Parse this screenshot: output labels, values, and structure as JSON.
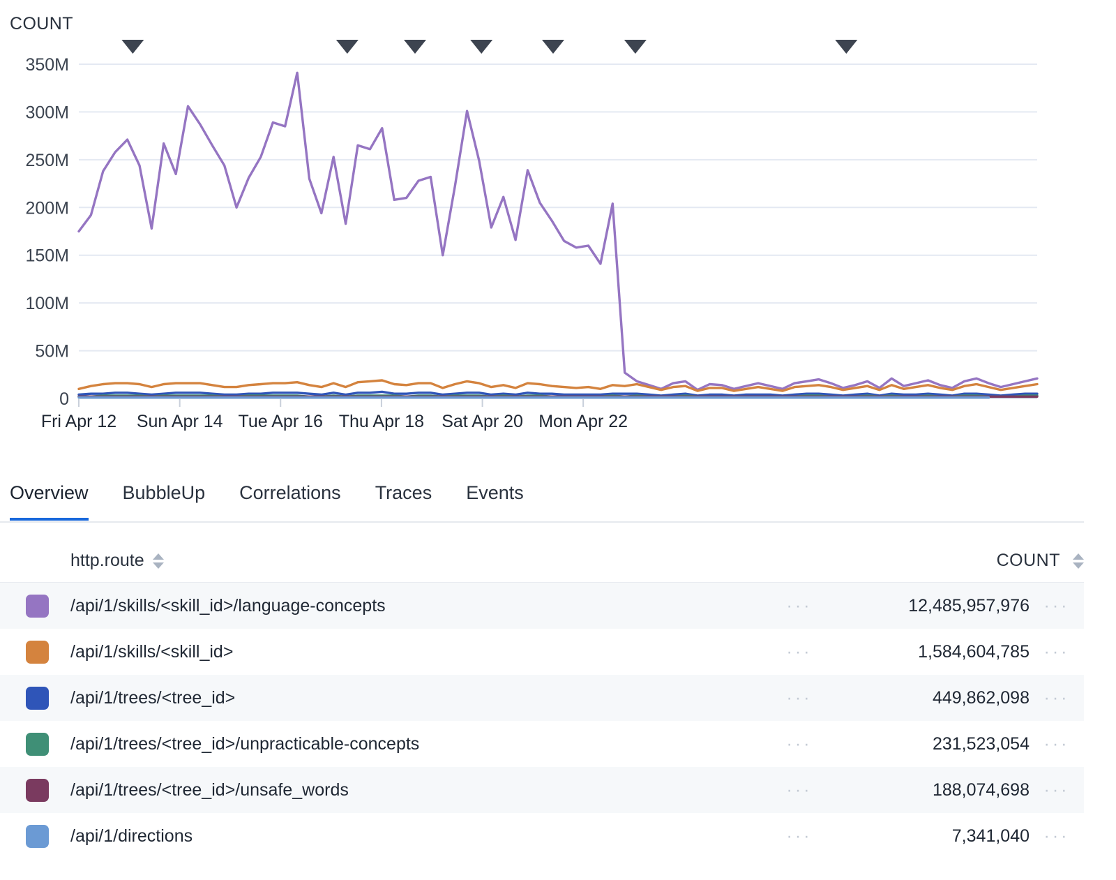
{
  "chart_data": {
    "type": "line",
    "title": "",
    "ylabel": "COUNT",
    "xlabel": "",
    "grid": true,
    "legend_position": "none",
    "ylim": [
      0,
      375000000
    ],
    "ytick_labels": [
      "350M",
      "300M",
      "250M",
      "200M",
      "150M",
      "100M",
      "50M",
      "0"
    ],
    "ytick_values": [
      350000000,
      300000000,
      250000000,
      200000000,
      150000000,
      100000000,
      50000000,
      0
    ],
    "xtick_labels": [
      "Fri Apr 12",
      "Sun Apr 14",
      "Tue Apr 16",
      "Thu Apr 18",
      "Sat Apr 20",
      "Mon Apr 22"
    ],
    "xtick_positions": [
      0,
      0.1053,
      0.2105,
      0.3158,
      0.4211,
      0.5263
    ],
    "annotation_markers": [
      0.0563,
      0.2801,
      0.3508,
      0.4201,
      0.4949,
      0.5807,
      0.8008
    ],
    "series": [
      {
        "name": "/api/1/skills/<skill_id>/language-concepts",
        "color": "#9575c2",
        "values": [
          175,
          192,
          238,
          258,
          271,
          244,
          178,
          267,
          235,
          306,
          287,
          265,
          244,
          200,
          231,
          253,
          289,
          285,
          341,
          230,
          194,
          253,
          183,
          265,
          261,
          283,
          208,
          210,
          228,
          232,
          150,
          222,
          301,
          249,
          179,
          211,
          166,
          239,
          205,
          186,
          165,
          158,
          160,
          141,
          204,
          27,
          18,
          14,
          10,
          16,
          18,
          9,
          15,
          14,
          10,
          13,
          16,
          13,
          10,
          16,
          18,
          20,
          16,
          11,
          14,
          18,
          11,
          21,
          13,
          16,
          19,
          14,
          11,
          18,
          21,
          16,
          12,
          15,
          18,
          21
        ]
      },
      {
        "name": "/api/1/skills/<skill_id>",
        "color": "#d4833e",
        "values": [
          10,
          13,
          15,
          16,
          16,
          15,
          12,
          15,
          16,
          16,
          16,
          14,
          12,
          12,
          14,
          15,
          16,
          16,
          17,
          14,
          12,
          16,
          12,
          17,
          18,
          19,
          15,
          14,
          16,
          16,
          11,
          15,
          18,
          16,
          12,
          14,
          11,
          16,
          15,
          13,
          12,
          11,
          12,
          10,
          14,
          13,
          15,
          12,
          9,
          12,
          13,
          8,
          11,
          11,
          8,
          10,
          12,
          10,
          8,
          12,
          13,
          14,
          12,
          9,
          11,
          13,
          9,
          14,
          10,
          12,
          14,
          11,
          9,
          13,
          15,
          12,
          9,
          11,
          13,
          15
        ]
      },
      {
        "name": "/api/1/trees/<tree_id>",
        "color": "#2f55b8",
        "values": [
          4,
          5,
          5,
          6,
          6,
          5,
          4,
          5,
          6,
          6,
          6,
          5,
          4,
          4,
          5,
          5,
          6,
          6,
          6,
          5,
          4,
          6,
          4,
          6,
          6,
          7,
          5,
          5,
          6,
          6,
          4,
          5,
          6,
          6,
          4,
          5,
          4,
          6,
          5,
          5,
          4,
          4,
          4,
          4,
          5,
          5,
          5,
          4,
          3,
          4,
          5,
          3,
          4,
          4,
          3,
          4,
          4,
          4,
          3,
          4,
          5,
          5,
          4,
          3,
          4,
          5,
          3,
          5,
          4,
          4,
          5,
          4,
          3,
          5,
          5,
          4,
          3,
          4,
          5,
          5
        ]
      },
      {
        "name": "/api/1/trees/<tree_id>/unpracticable-concepts",
        "color": "#3f8f76",
        "values": [
          2,
          2,
          3,
          3,
          3,
          3,
          2,
          3,
          3,
          3,
          3,
          3,
          2,
          2,
          3,
          3,
          3,
          3,
          3,
          2,
          2,
          3,
          2,
          3,
          3,
          3,
          3,
          2,
          3,
          3,
          2,
          3,
          3,
          3,
          2,
          3,
          2,
          3,
          3,
          2,
          2,
          2,
          2,
          2,
          3,
          2,
          3,
          2,
          2,
          2,
          3,
          2,
          2,
          2,
          2,
          2,
          2,
          2,
          2,
          2,
          3,
          3,
          2,
          2,
          2,
          3,
          2,
          3,
          2,
          2,
          3,
          2,
          2,
          3,
          3,
          2,
          2,
          2,
          3,
          3
        ]
      },
      {
        "name": "/api/1/trees/<tree_id>/unsafe_words",
        "color": "#7a3a5f",
        "values": [
          2,
          2,
          2,
          2,
          2,
          2,
          2,
          2,
          2,
          2,
          2,
          2,
          2,
          2,
          2,
          2,
          2,
          2,
          2,
          2,
          2,
          2,
          2,
          2,
          2,
          2,
          2,
          2,
          2,
          2,
          2,
          2,
          2,
          2,
          2,
          2,
          2,
          2,
          2,
          2,
          2,
          2,
          2,
          2,
          2,
          2,
          2,
          2,
          2,
          2,
          2,
          2,
          2,
          2,
          2,
          2,
          2,
          2,
          2,
          2,
          2,
          2,
          2,
          2,
          2,
          2,
          2,
          2,
          2,
          2,
          2,
          2,
          2,
          2,
          2,
          2,
          2,
          2,
          2,
          2
        ]
      },
      {
        "name": "/api/1/directions",
        "color": "#6b9ad4",
        "values": [
          1,
          1,
          1,
          1,
          1,
          1,
          1,
          1,
          1,
          1,
          1,
          1,
          1,
          1,
          1,
          1,
          1,
          1,
          1,
          1,
          1,
          1,
          1,
          1,
          1,
          1,
          1,
          1,
          1,
          1,
          1,
          1,
          1,
          1,
          1,
          1,
          1,
          1,
          1,
          1,
          1,
          1,
          1,
          1,
          1,
          1,
          1,
          1,
          1,
          1,
          1,
          1,
          1,
          1,
          1,
          1,
          1,
          1,
          1,
          1,
          1,
          1,
          1,
          1,
          1,
          1,
          1,
          1,
          1,
          1,
          1,
          1,
          1,
          1,
          1,
          1
        ]
      }
    ],
    "value_unit": "millions"
  },
  "chart": {
    "axis_title": "COUNT"
  },
  "tabs": [
    {
      "label": "Overview",
      "active": true
    },
    {
      "label": "BubbleUp",
      "active": false
    },
    {
      "label": "Correlations",
      "active": false
    },
    {
      "label": "Traces",
      "active": false
    },
    {
      "label": "Events",
      "active": false
    }
  ],
  "table": {
    "columns": {
      "route": "http.route",
      "count": "COUNT"
    },
    "overflow_glyph": "···",
    "rows": [
      {
        "color": "#9575c2",
        "route": "/api/1/skills/<skill_id>/language-concepts",
        "count": "12,485,957,976"
      },
      {
        "color": "#d4833e",
        "route": "/api/1/skills/<skill_id>",
        "count": "1,584,604,785"
      },
      {
        "color": "#2f55b8",
        "route": "/api/1/trees/<tree_id>",
        "count": "449,862,098"
      },
      {
        "color": "#3f8f76",
        "route": "/api/1/trees/<tree_id>/unpracticable-concepts",
        "count": "231,523,054"
      },
      {
        "color": "#7a3a5f",
        "route": "/api/1/trees/<tree_id>/unsafe_words",
        "count": "188,074,698"
      },
      {
        "color": "#6b9ad4",
        "route": "/api/1/directions",
        "count": "7,341,040"
      }
    ]
  }
}
